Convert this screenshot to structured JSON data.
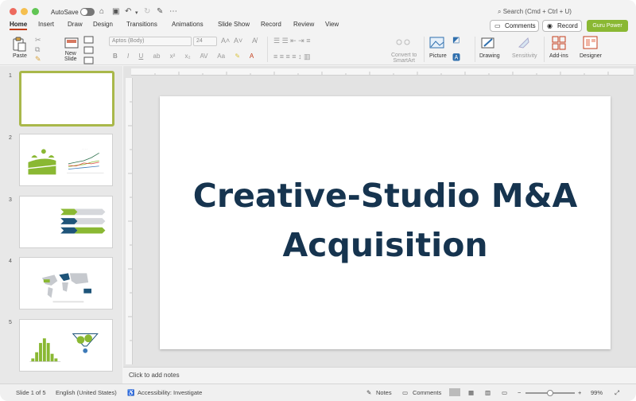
{
  "titlebar": {
    "autosave_label": "AutoSave",
    "search_placeholder": "Search (Cmd + Ctrl + U)"
  },
  "tabs": [
    "Home",
    "Insert",
    "Draw",
    "Design",
    "Transitions",
    "Animations",
    "Slide Show",
    "Record",
    "Review",
    "View"
  ],
  "header_buttons": {
    "comments": "Comments",
    "record": "Record",
    "guru": "Guru Power"
  },
  "ribbon": {
    "paste": "Paste",
    "new_slide": "New\nSlide",
    "font_name": "Aptos (Body)",
    "font_size": "24",
    "convert_smartart": "Convert to\nSmartArt",
    "picture": "Picture",
    "drawing": "Drawing",
    "sensitivity": "Sensitivity",
    "addins": "Add-ins",
    "designer": "Designer"
  },
  "slides": [
    {
      "number": "1"
    },
    {
      "number": "2"
    },
    {
      "number": "3"
    },
    {
      "number": "4"
    },
    {
      "number": "5"
    }
  ],
  "slide": {
    "title_line1": "Creative-Studio M&A",
    "title_line2": "Acquisition"
  },
  "notes_placeholder": "Click to add notes",
  "status": {
    "slide_of": "Slide 1 of 5",
    "language": "English (United States)",
    "accessibility": "Accessibility: Investigate",
    "notes": "Notes",
    "comments": "Comments",
    "zoom": "99%"
  },
  "colors": {
    "accent_tab": "#c43e1c",
    "guru": "#8ab833",
    "title_text": "#16344f",
    "thumb_green": "#8ab833",
    "thumb_blue": "#1e5479"
  }
}
